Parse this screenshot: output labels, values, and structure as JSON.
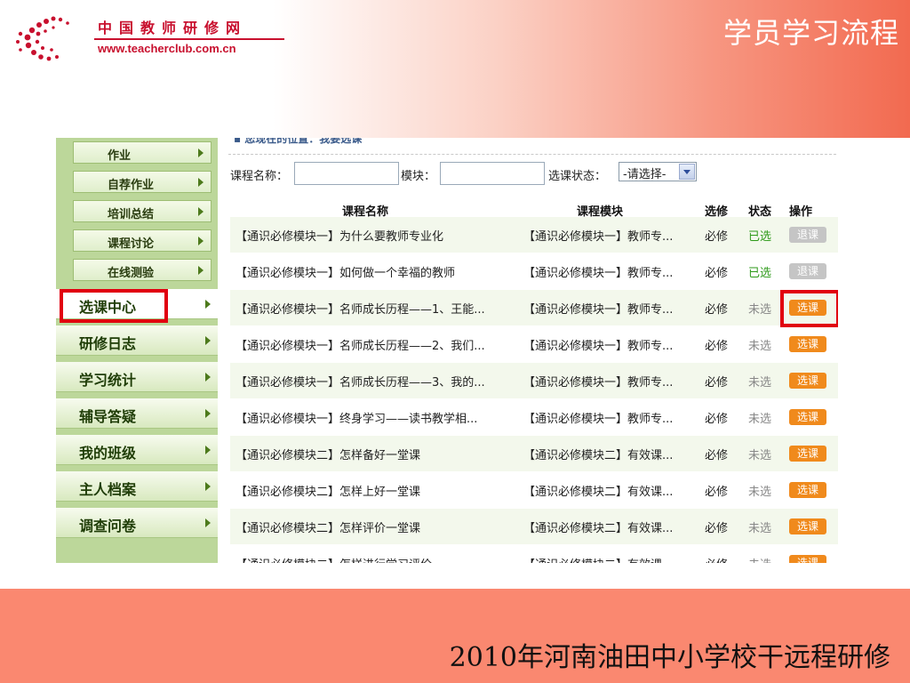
{
  "slide": {
    "title": "学员学习流程",
    "footer": "2010年河南油田中小学校干远程研修"
  },
  "logo": {
    "name_cn": "中国教师研修网",
    "url": "www.teacherclub.com.cn"
  },
  "breadcrumb": "▪ 您现在的位置：我要选课",
  "sidebar": {
    "sub_items": [
      "作业",
      "自荐作业",
      "培训总结",
      "课程讨论",
      "在线测验"
    ],
    "main_items": [
      "选课中心",
      "研修日志",
      "学习统计",
      "辅导答疑",
      "我的班级",
      "主人档案",
      "调查问卷"
    ],
    "active_item": "选课中心"
  },
  "filter": {
    "course_name_label": "课程名称：",
    "module_label": "模块：",
    "status_label": "选课状态：",
    "status_value": "-请选择-"
  },
  "table": {
    "headers": [
      "课程名称",
      "课程模块",
      "选修",
      "状态",
      "操作"
    ],
    "rows": [
      {
        "name": "【通识必修模块一】为什么要教师专业化",
        "module": "【通识必修模块一】教师专...",
        "type": "必修",
        "status": "已选",
        "action": "退课"
      },
      {
        "name": "【通识必修模块一】如何做一个幸福的教师",
        "module": "【通识必修模块一】教师专...",
        "type": "必修",
        "status": "已选",
        "action": "退课"
      },
      {
        "name": "【通识必修模块一】名师成长历程——1、王能...",
        "module": "【通识必修模块一】教师专...",
        "type": "必修",
        "status": "未选",
        "action": "选课"
      },
      {
        "name": "【通识必修模块一】名师成长历程——2、我们...",
        "module": "【通识必修模块一】教师专...",
        "type": "必修",
        "status": "未选",
        "action": "选课"
      },
      {
        "name": "【通识必修模块一】名师成长历程——3、我的...",
        "module": "【通识必修模块一】教师专...",
        "type": "必修",
        "status": "未选",
        "action": "选课"
      },
      {
        "name": "【通识必修模块一】终身学习——读书教学相...",
        "module": "【通识必修模块一】教师专...",
        "type": "必修",
        "status": "未选",
        "action": "选课"
      },
      {
        "name": "【通识必修模块二】怎样备好一堂课",
        "module": "【通识必修模块二】有效课...",
        "type": "必修",
        "status": "未选",
        "action": "选课"
      },
      {
        "name": "【通识必修模块二】怎样上好一堂课",
        "module": "【通识必修模块二】有效课...",
        "type": "必修",
        "status": "未选",
        "action": "选课"
      },
      {
        "name": "【通识必修模块二】怎样评价一堂课",
        "module": "【通识必修模块二】有效课...",
        "type": "必修",
        "status": "未选",
        "action": "选课"
      },
      {
        "name": "【通识必修模块二】怎样进行学习评价",
        "module": "【通识必修模块二】有效课",
        "type": "必修",
        "status": "未选",
        "action": "选课"
      }
    ]
  },
  "colors": {
    "brand_red": "#c8102e",
    "highlight_red": "#e1000f",
    "sidebar_green": "#bcd79a",
    "selected_status": "#2e9a1a",
    "select_button": "#f08a1c",
    "drop_button": "#c5c5c5",
    "footer_salmon": "#fa8870"
  }
}
